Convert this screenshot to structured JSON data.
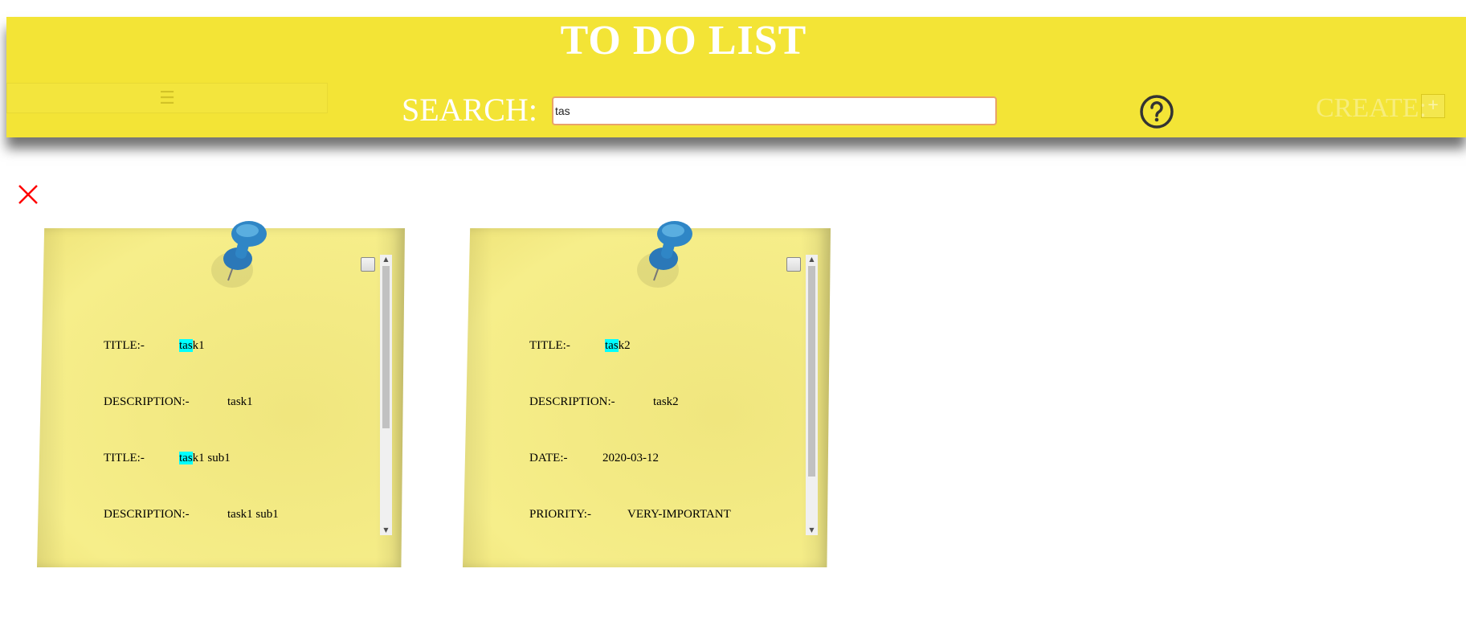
{
  "header": {
    "title": "TO DO LIST",
    "menu_icon": "hamburger-icon",
    "search_label": "SEARCH:",
    "search_value": "tas",
    "help_icon": "question-mark-icon",
    "create_label": "CREATE:",
    "create_button": "+"
  },
  "colors": {
    "header_bg": "#f3e436",
    "note_bg": "#f3ea84",
    "highlight": "#00ffff",
    "close_icon": "#ff0000",
    "pin": "#2b7fbe"
  },
  "close_icon": "close-x-icon",
  "notes": [
    {
      "rows": [
        {
          "label": "TITLE:-",
          "match": "tas",
          "rest": "k1"
        },
        {
          "label": "DESCRIPTION:-",
          "value": "task1"
        },
        {
          "label": "TITLE:-",
          "match": "tas",
          "rest": "k1 sub1"
        },
        {
          "label": "DESCRIPTION:-",
          "value": "task1 sub1"
        }
      ]
    },
    {
      "rows": [
        {
          "label": "TITLE:-",
          "match": "tas",
          "rest": "k2"
        },
        {
          "label": "DESCRIPTION:-",
          "value": "task2"
        },
        {
          "label": "DATE:-",
          "value": "2020-03-12"
        },
        {
          "label": "PRIORITY:-",
          "value": "VERY-IMPORTANT"
        }
      ]
    }
  ]
}
